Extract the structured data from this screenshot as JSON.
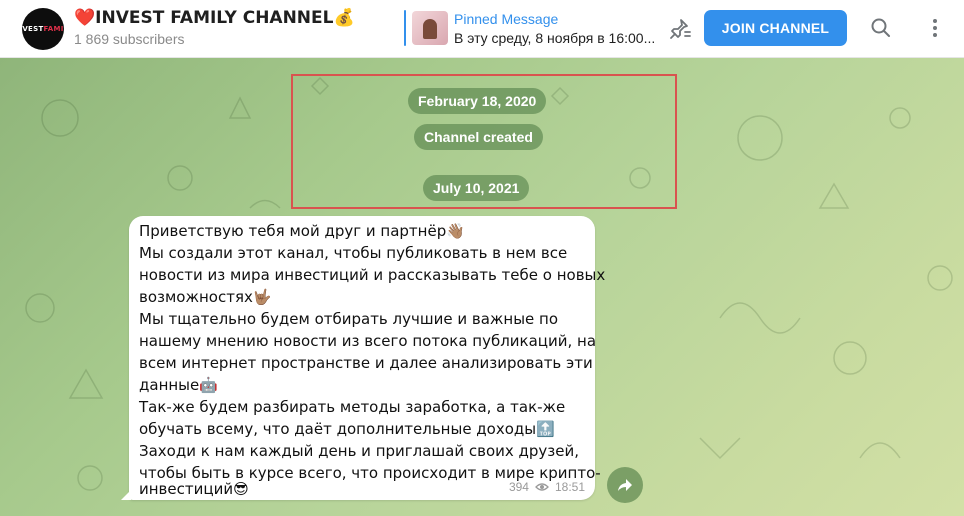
{
  "header": {
    "avatar_text_a": "INVEST",
    "avatar_text_b": "FAMILY",
    "title": "❤️INVEST FAMILY CHANNEL💰",
    "subscribers": "1 869 subscribers",
    "pinned_label": "Pinned Message",
    "pinned_text": "В эту среду, 8 ноября в 16:00...",
    "join_label": "JOIN CHANNEL",
    "icons": [
      "pin-list-icon",
      "search-icon",
      "more-icon"
    ]
  },
  "chat": {
    "date1": "February 18, 2020",
    "service1": "Channel created",
    "date2": "July 10, 2021",
    "message": {
      "lines": [
        "Приветствую тебя мой друг и партнёр👋🏽",
        "Мы создали этот канал, чтобы публиковать в нем все",
        "новости из мира инвестиций и рассказывать тебе о новых",
        "возможностях🤟🏽",
        "Мы тщательно будем отбирать лучшие и важные по",
        "нашему мнению новости из всего потока публикаций, на",
        "всем интернет пространстве и далее анализировать эти",
        "данные🤖",
        "Так-же будем разбирать методы заработка, а так-же",
        "обучать всему, что даёт дополнительные доходы🔝",
        "Заходи к нам каждый день и приглашай своих друзей,",
        "чтобы быть в курсе всего, что происходит в мире крипто-",
        "инвестиций😎"
      ],
      "views": "394",
      "time": "18:51"
    }
  },
  "colors": {
    "accent": "#3390ec",
    "highlight_box": "#d9534f",
    "chat_background": "#a6c98c"
  }
}
